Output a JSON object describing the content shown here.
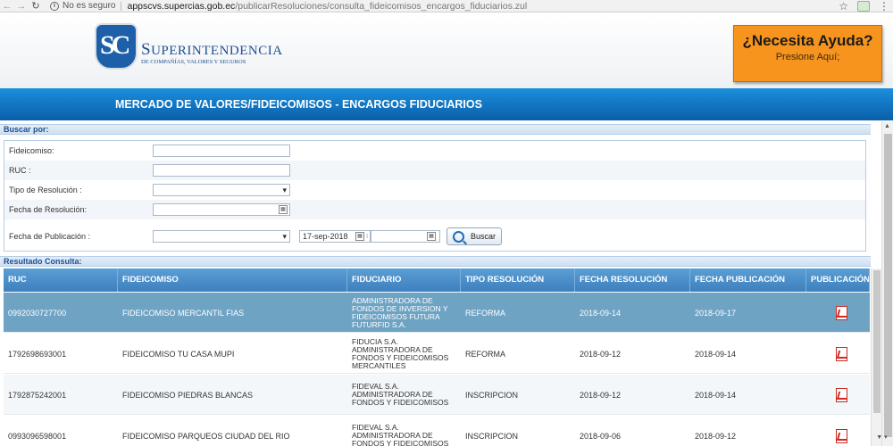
{
  "browser": {
    "security_label": "No es seguro",
    "url_host": "appscvs.supercias.gob.ec",
    "url_path": "/publicarResoluciones/consulta_fideicomisos_encargos_fiduciarios.zul"
  },
  "header": {
    "brand_initial": "S",
    "brand_rest": "UPERINTENDENCIA",
    "brand_sub": "DE COMPAÑÍAS, VALORES Y SEGUROS",
    "logo_text": "SC",
    "help_title": "¿Necesita Ayuda?",
    "help_sub": "Presione Aquí;"
  },
  "banner": {
    "title": "MERCADO DE VALORES/FIDEICOMISOS - ENCARGOS FIDUCIARIOS"
  },
  "search": {
    "section_title": "Buscar por:",
    "fideicomiso_label": "Fideicomiso:",
    "fideicomiso_value": "",
    "ruc_label": "RUC :",
    "ruc_value": "",
    "tipo_label": "Tipo de Resolución :",
    "tipo_value": "",
    "fecha_res_label": "Fecha de Resolución:",
    "fecha_res_value": "",
    "fecha_pub_label": "Fecha de Publicación :",
    "fecha_pub_select": "",
    "fecha_pub_from": "17-sep-2018",
    "fecha_pub_to": "",
    "buscar_label": "Buscar"
  },
  "results": {
    "section_title": "Resultado Consulta:",
    "columns": [
      "RUC",
      "FIDEICOMISO",
      "FIDUCIARIO",
      "TIPO RESOLUCIÓN",
      "FECHA RESOLUCIÓN",
      "FECHA PUBLICACIÓN",
      "PUBLICACIÓN"
    ],
    "rows": [
      {
        "ruc": "0992030727700",
        "fideicomiso": "FIDEICOMISO MERCANTIL FIAS",
        "fiduciario": "ADMINISTRADORA DE FONDOS DE INVERSION Y FIDEICOMISOS FUTURA FUTURFID S.A.",
        "tipo": "REFORMA",
        "fecha_res": "2018-09-14",
        "fecha_pub": "2018-09-17"
      },
      {
        "ruc": "1792698693001",
        "fideicomiso": "FIDEICOMISO TU CASA MUPI",
        "fiduciario": "FIDUCIA S.A. ADMINISTRADORA DE FONDOS Y FIDEICOMISOS MERCANTILES",
        "tipo": "REFORMA",
        "fecha_res": "2018-09-12",
        "fecha_pub": "2018-09-14"
      },
      {
        "ruc": "1792875242001",
        "fideicomiso": "FIDEICOMISO PIEDRAS BLANCAS",
        "fiduciario": "FIDEVAL S.A. ADMINISTRADORA DE FONDOS Y FIDEICOMISOS",
        "tipo": "INSCRIPCION",
        "fecha_res": "2018-09-12",
        "fecha_pub": "2018-09-14"
      },
      {
        "ruc": "0993096598001",
        "fideicomiso": "FIDEICOMISO PARQUEOS CIUDAD DEL RIO",
        "fiduciario": "FIDEVAL S.A. ADMINISTRADORA DE FONDOS Y FIDEICOMISOS",
        "tipo": "INSCRIPCION",
        "fecha_res": "2018-09-06",
        "fecha_pub": "2018-09-12"
      }
    ]
  },
  "colors": {
    "banner": "#0b5ea9",
    "help": "#f7941d",
    "selected_row": "#6fa3c4",
    "header_row": "#4a8cc8"
  }
}
